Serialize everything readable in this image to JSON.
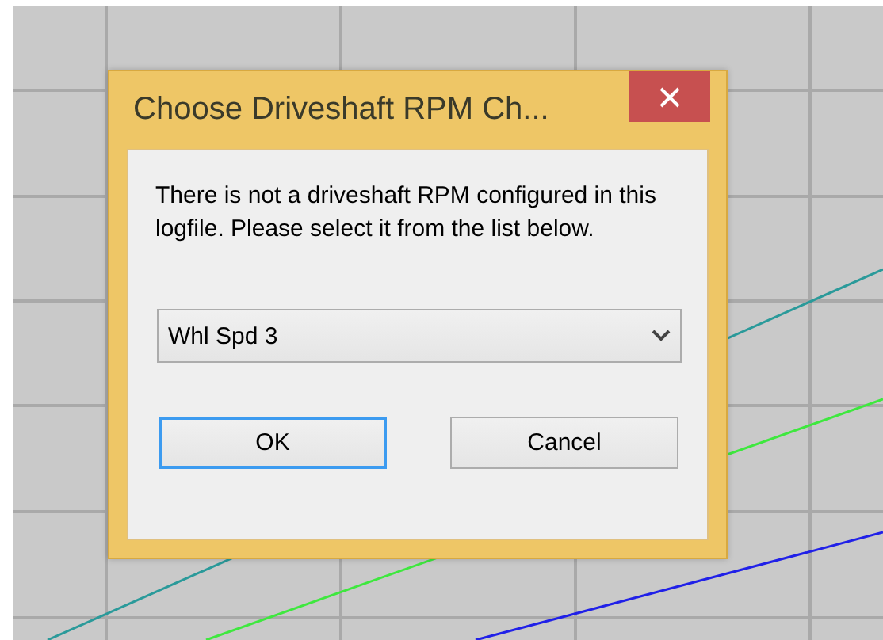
{
  "dialog": {
    "title": "Choose Driveshaft RPM Ch...",
    "message": "There is not a driveshaft RPM configured in this logfile. Please select it from the list below.",
    "channel_select": {
      "value": "Whl Spd 3"
    },
    "buttons": [
      {
        "label": "OK",
        "focused": true
      },
      {
        "label": "Cancel",
        "focused": false
      }
    ]
  }
}
